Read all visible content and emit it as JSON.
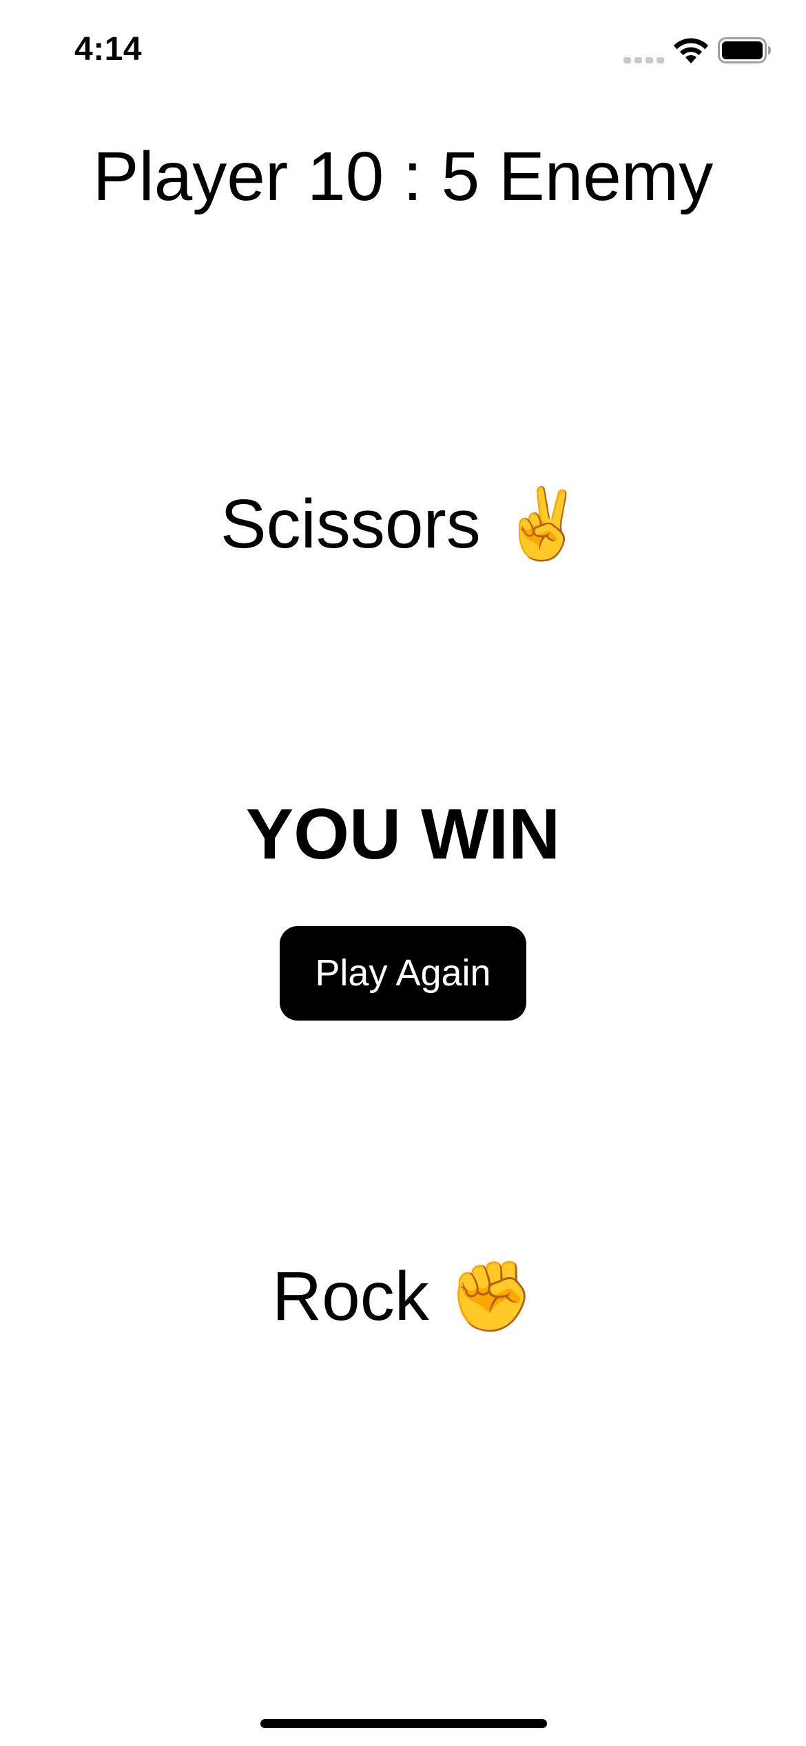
{
  "status_bar": {
    "time": "4:14",
    "icons": [
      "cellular-signal-icon",
      "wifi-icon",
      "battery-icon"
    ]
  },
  "game": {
    "score_text": "Player 10 : 5 Enemy",
    "enemy_move": "Scissors ✌️",
    "result": "YOU WIN",
    "play_again_label": "Play Again",
    "player_move": "Rock ✊"
  },
  "colors": {
    "background": "#ffffff",
    "text": "#000000",
    "button_bg": "#000000",
    "button_text": "#ffffff"
  }
}
